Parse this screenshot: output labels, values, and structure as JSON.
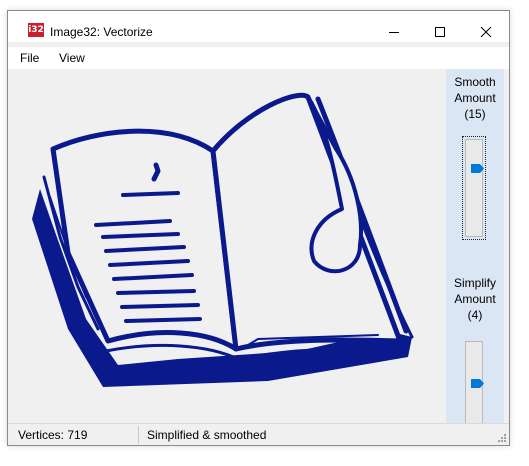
{
  "window": {
    "title": "Image32: Vectorize",
    "app_icon_text": "i32"
  },
  "menu": {
    "items": [
      "File",
      "View"
    ]
  },
  "sidebar": {
    "smooth": {
      "label_line1": "Smooth",
      "label_line2": "Amount",
      "value_text": "(15)"
    },
    "simplify": {
      "label_line1": "Simplify",
      "label_line2": "Amount",
      "value_text": "(4)"
    }
  },
  "status": {
    "vertices": "Vertices: 719",
    "message": "Simplified & smoothed"
  },
  "colors": {
    "accent": "#0078d7",
    "drawing": "#0a1a8c",
    "sidebar": "#dbe6f4"
  },
  "canvas": {
    "image_content": "vectorized open book line drawing"
  }
}
